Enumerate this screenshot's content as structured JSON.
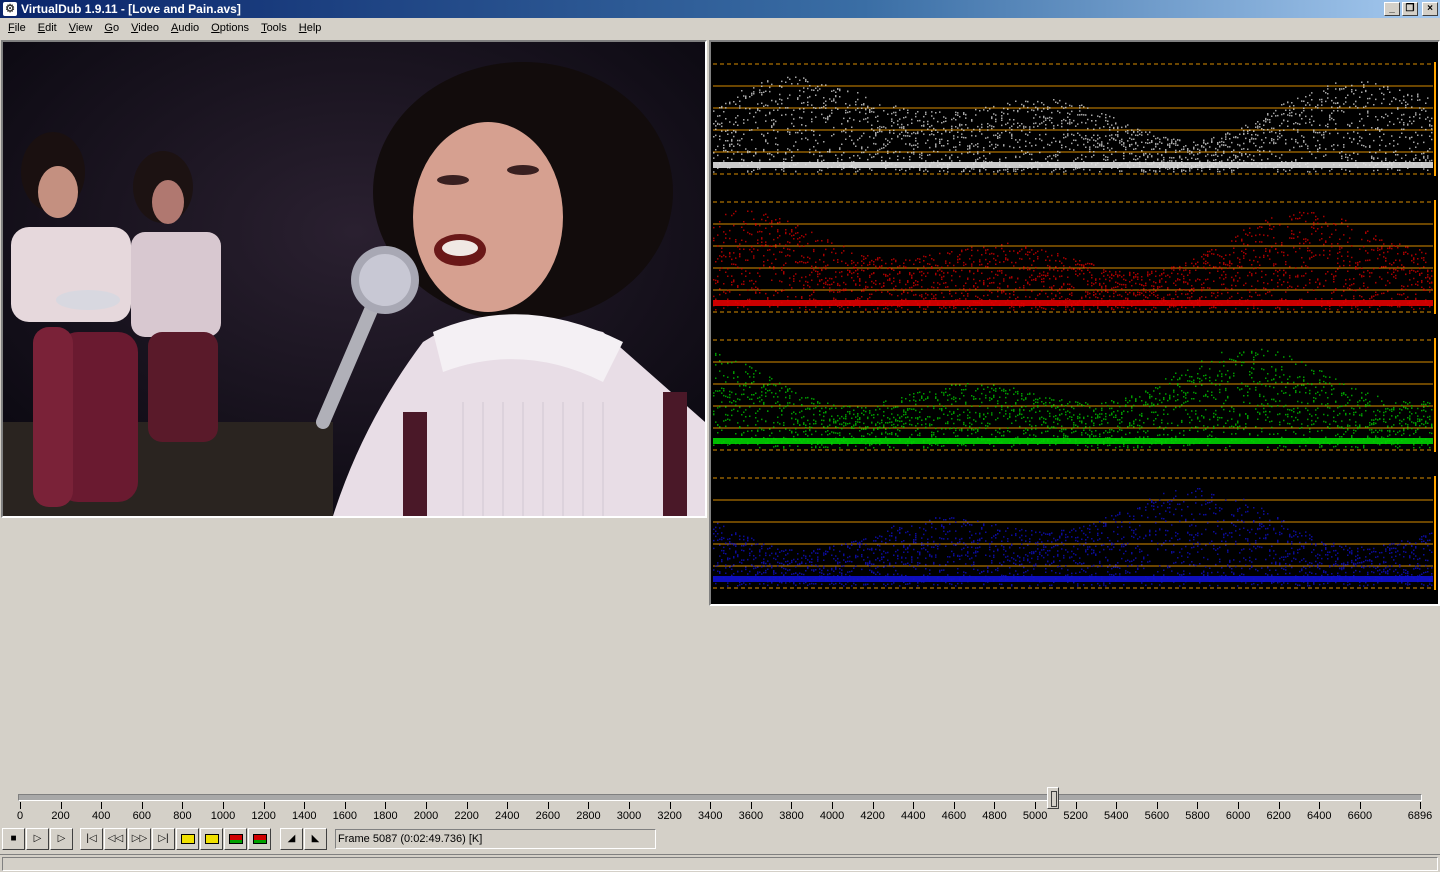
{
  "window": {
    "title": "VirtualDub 1.9.11 - [Love and Pain.avs]",
    "icon": "virtualdub-icon",
    "minimize_glyph": "_",
    "restore_glyph": "❐",
    "close_glyph": "×"
  },
  "menu": {
    "items": [
      {
        "label": "File"
      },
      {
        "label": "Edit"
      },
      {
        "label": "View"
      },
      {
        "label": "Go"
      },
      {
        "label": "Video"
      },
      {
        "label": "Audio"
      },
      {
        "label": "Options"
      },
      {
        "label": "Tools"
      },
      {
        "label": "Help"
      }
    ]
  },
  "panes": {
    "input": {
      "content": "video-frame"
    },
    "output": {
      "content": "rgb-histogram-waveforms",
      "channels": [
        {
          "name": "luma",
          "color": "#e0e0e0"
        },
        {
          "name": "red",
          "color": "#e00000"
        },
        {
          "name": "green",
          "color": "#00d000"
        },
        {
          "name": "blue",
          "color": "#1010d0"
        }
      ],
      "guide_color": "#ffa500"
    }
  },
  "timeline": {
    "min": 0,
    "max": 6896,
    "current_frame": 5087,
    "tick_labels": [
      "0",
      "200",
      "400",
      "600",
      "800",
      "1000",
      "1200",
      "1400",
      "1600",
      "1800",
      "2000",
      "2200",
      "2400",
      "2600",
      "2800",
      "3000",
      "3200",
      "3400",
      "3600",
      "3800",
      "4000",
      "4200",
      "4400",
      "4600",
      "4800",
      "5000",
      "5200",
      "5400",
      "5600",
      "5800",
      "6000",
      "6200",
      "6400",
      "6600",
      "6896"
    ],
    "tick_values": [
      0,
      200,
      400,
      600,
      800,
      1000,
      1200,
      1400,
      1600,
      1800,
      2000,
      2200,
      2400,
      2600,
      2800,
      3000,
      3200,
      3400,
      3600,
      3800,
      4000,
      4200,
      4400,
      4600,
      4800,
      5000,
      5200,
      5400,
      5600,
      5800,
      6000,
      6200,
      6400,
      6600,
      6896
    ]
  },
  "toolbar": {
    "buttons": [
      {
        "name": "stop-button",
        "glyph": "■"
      },
      {
        "name": "play-input-button",
        "glyph": "▷"
      },
      {
        "name": "play-output-button",
        "glyph": "▷"
      },
      {
        "name": "go-start-button",
        "glyph": "|◁"
      },
      {
        "name": "prev-frame-button",
        "glyph": "◁◁"
      },
      {
        "name": "next-frame-button",
        "glyph": "▷▷"
      },
      {
        "name": "go-end-button",
        "glyph": "▷|"
      },
      {
        "name": "prev-keyframe-button",
        "glyph": ""
      },
      {
        "name": "next-keyframe-button",
        "glyph": ""
      },
      {
        "name": "prev-scene-button",
        "glyph": ""
      },
      {
        "name": "next-scene-button",
        "glyph": ""
      },
      {
        "name": "mark-in-button",
        "glyph": "◢"
      },
      {
        "name": "mark-out-button",
        "glyph": "◣"
      }
    ],
    "frame_status": "Frame 5087 (0:02:49.736) [K]"
  }
}
